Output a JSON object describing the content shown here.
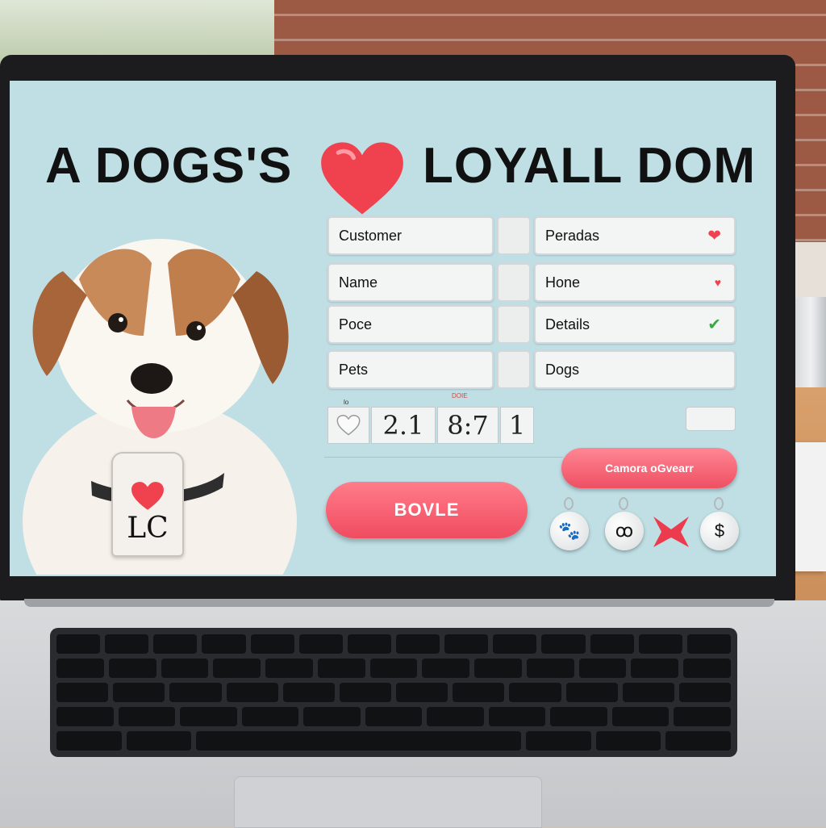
{
  "header": {
    "title_left": "A DOGS'S",
    "title_right": "LOYALL DOM",
    "heart_icon": "heart-icon"
  },
  "hero": {
    "image": "puppy-photo",
    "tag_text": "LC"
  },
  "form": {
    "left_fields": [
      {
        "label": "Customer"
      },
      {
        "label": "Name"
      },
      {
        "label": "Poce"
      },
      {
        "label": "Pets"
      }
    ],
    "right_fields": [
      {
        "label": "Peradas",
        "status_icon": "heart-icon",
        "status_glyph": "❤"
      },
      {
        "label": "Hone",
        "status_icon": "heart-icon",
        "status_glyph": "♥"
      },
      {
        "label": "Details",
        "status_icon": "check-icon",
        "status_glyph": "✔"
      },
      {
        "label": "Dogs",
        "status_icon": "",
        "status_glyph": ""
      }
    ]
  },
  "counter": {
    "label_left": "lo",
    "label_right": "DOIE",
    "digits": [
      "2.1",
      "8:7",
      "1"
    ]
  },
  "buttons": {
    "primary_label": "BOVLE",
    "secondary_label": "Camora oGvearr"
  },
  "charms": [
    {
      "icon": "paw-icon",
      "glyph": "🐾"
    },
    {
      "icon": "clover-icon",
      "glyph": "ꝏ"
    },
    {
      "icon": "close-icon",
      "glyph": ""
    },
    {
      "icon": "dollar-icon",
      "glyph": "$"
    }
  ],
  "colors": {
    "screen_bg": "#bfdfe5",
    "accent_red": "#f04c60",
    "check_green": "#3aa845"
  }
}
